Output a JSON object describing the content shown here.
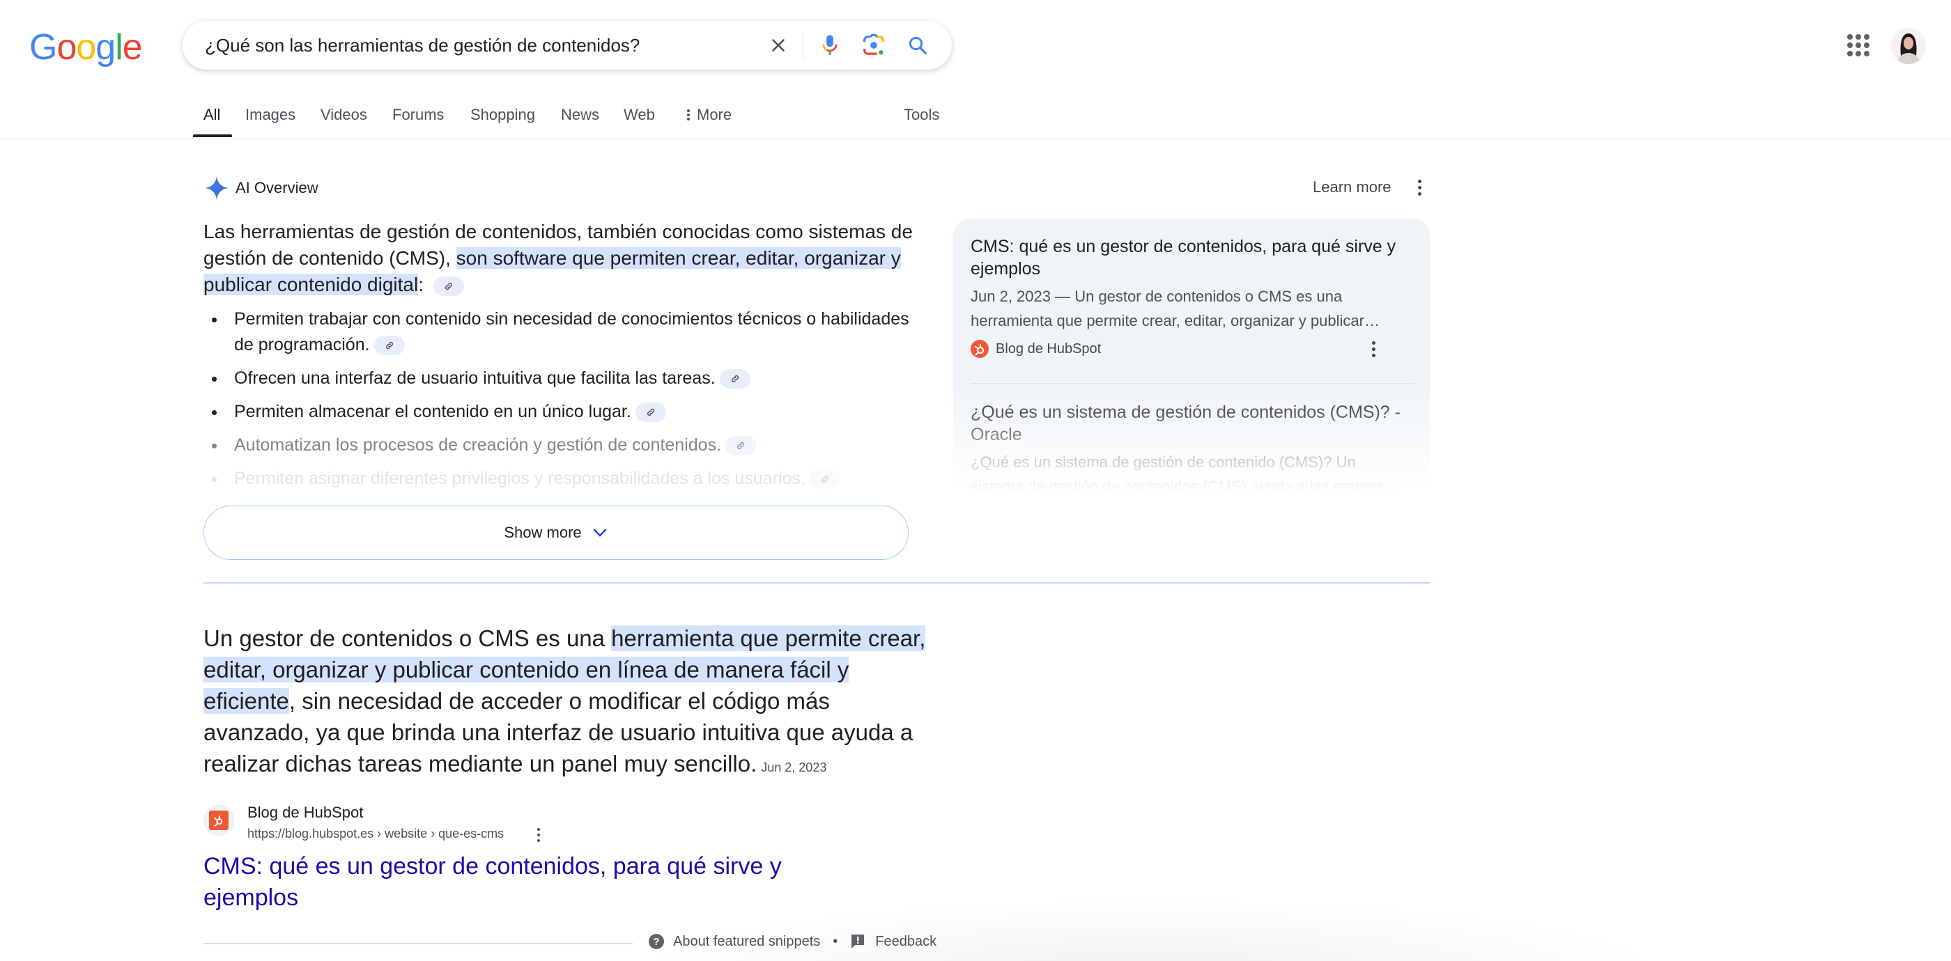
{
  "logo": {
    "letters": [
      "G",
      "o",
      "o",
      "g",
      "l",
      "e"
    ],
    "label": "Google"
  },
  "search": {
    "query": "¿Qué son las herramientas de gestión de contenidos?",
    "icons": [
      "close-icon",
      "microphone-icon",
      "google-lens-icon",
      "search-icon"
    ]
  },
  "header": {
    "apps_icon": "google-apps-icon",
    "avatar": "account-avatar"
  },
  "tabs": [
    {
      "label": "All",
      "active": true
    },
    {
      "label": "Images"
    },
    {
      "label": "Videos"
    },
    {
      "label": "Forums"
    },
    {
      "label": "Shopping"
    },
    {
      "label": "News"
    },
    {
      "label": "Web"
    },
    {
      "label": "More",
      "icon": "more-vert-icon"
    },
    {
      "label": "Tools"
    }
  ],
  "ai_overview": {
    "label": "AI Overview",
    "learn_more": "Learn more",
    "lead_plain": "Las herramientas de gestión de contenidos, también conocidas como sistemas de gestión de contenido (CMS), ",
    "lead_highlight": "son software que permiten crear, editar, organizar y publicar contenido digital",
    "lead_end": ":",
    "bullets": [
      "Permiten trabajar con contenido sin necesidad de conocimientos técnicos o habilidades de programación.",
      "Ofrecen una interfaz de usuario intuitiva que facilita las tareas.",
      "Permiten almacenar el contenido en un único lugar.",
      "Automatizan los procesos de creación y gestión de contenidos.",
      "Permiten asignar diferentes privilegios y responsabilidades a los usuarios."
    ],
    "show_more": "Show more",
    "sources": [
      {
        "title": "CMS: qué es un gestor de contenidos, para qué sirve y ejemplos",
        "snippet": "Jun 2, 2023 — Un gestor de contenidos o CMS es una herramienta que permite crear, editar, organizar y publicar…",
        "site": "Blog de HubSpot"
      },
      {
        "title": "¿Qué es un sistema de gestión de contenidos (CMS)? - Oracle",
        "snippet": "¿Qué es un sistema de gestión de contenido (CMS)? Un sistema de gestión de contenidos (CMS) ayuda a las empres…"
      }
    ]
  },
  "featured_snippet": {
    "text_before": "Un gestor de contenidos o CMS es una ",
    "text_highlight": "herramienta que permite crear, editar, organizar y publicar contenido en línea de manera fácil y eficiente",
    "text_after": ", sin necesidad de acceder o modificar el código más avanzado, ya que brinda una interfaz de usuario intuitiva que ayuda a realizar dichas tareas mediante un panel muy sencillo.",
    "date": "Jun 2, 2023",
    "site_name": "Blog de HubSpot",
    "url": "https://blog.hubspot.es › website › que-es-cms",
    "title": "CMS: qué es un gestor de contenidos, para qué sirve y ejemplos",
    "about": "About featured snippets",
    "separator": "•",
    "feedback": "Feedback"
  },
  "colors": {
    "link": "#1a0dab",
    "highlight": "#d3e3fd",
    "accent": "#4285f4",
    "hubspot": "#ef5a34"
  }
}
